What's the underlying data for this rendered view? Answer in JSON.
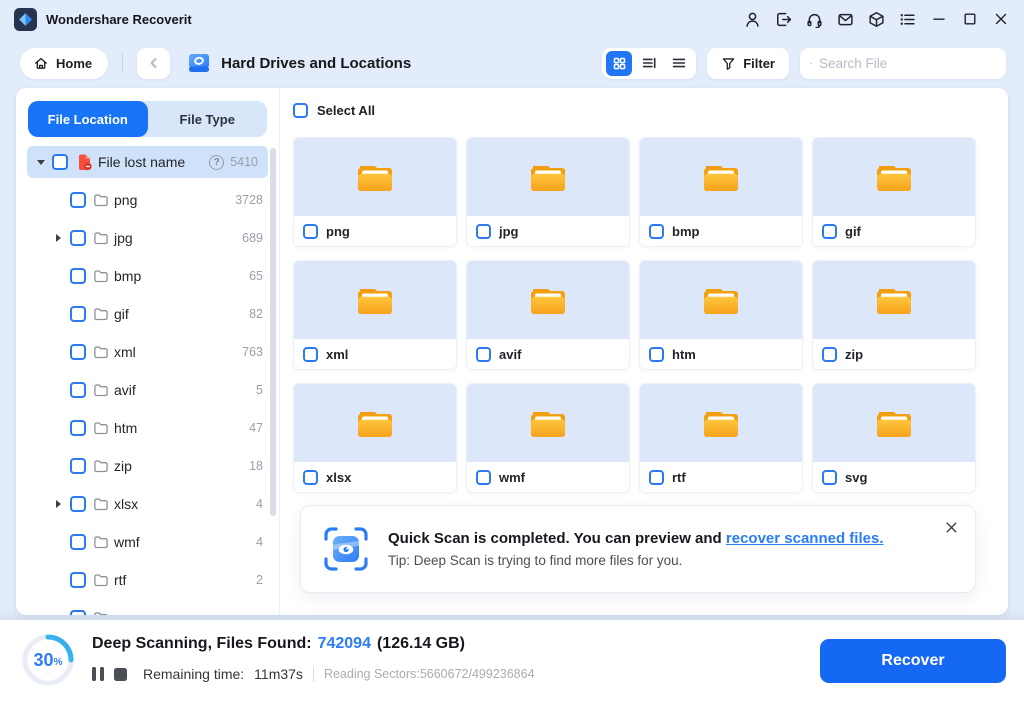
{
  "titlebar": {
    "app_title": "Wondershare Recoverit"
  },
  "toolbar": {
    "home_label": "Home",
    "breadcrumb_title": "Hard Drives and Locations",
    "filter_label": "Filter",
    "search_placeholder": "Search File"
  },
  "sidebar": {
    "tabs": [
      {
        "label": "File Location"
      },
      {
        "label": "File Type"
      }
    ],
    "root": {
      "label": "File lost name",
      "count": "5410"
    },
    "tree": [
      {
        "label": "png",
        "count": "3728"
      },
      {
        "label": "jpg",
        "count": "689"
      },
      {
        "label": "bmp",
        "count": "65"
      },
      {
        "label": "gif",
        "count": "82"
      },
      {
        "label": "xml",
        "count": "763"
      },
      {
        "label": "avif",
        "count": "5"
      },
      {
        "label": "htm",
        "count": "47"
      },
      {
        "label": "zip",
        "count": "18"
      },
      {
        "label": "xlsx",
        "count": "4"
      },
      {
        "label": "wmf",
        "count": "4"
      },
      {
        "label": "rtf",
        "count": "2"
      }
    ]
  },
  "main": {
    "select_all_label": "Select All",
    "folders": [
      {
        "label": "png"
      },
      {
        "label": "jpg"
      },
      {
        "label": "bmp"
      },
      {
        "label": "gif"
      },
      {
        "label": "xml"
      },
      {
        "label": "avif"
      },
      {
        "label": "htm"
      },
      {
        "label": "zip"
      },
      {
        "label": "xlsx"
      },
      {
        "label": "wmf"
      },
      {
        "label": "rtf"
      },
      {
        "label": "svg"
      }
    ],
    "notification": {
      "message": "Quick Scan is completed. You can preview and",
      "link": "recover scanned files.",
      "tip": "Tip: Deep Scan is trying to find more files for you."
    }
  },
  "footer": {
    "progress_value": "30",
    "progress_unit": "%",
    "status_label": "Deep Scanning, Files Found:",
    "files_found": "742094",
    "size_found": "(126.14 GB)",
    "remaining_label": "Remaining time:",
    "remaining_value": "11m37s",
    "sectors_label": "Reading Sectors:5660672/499236864",
    "recover_label": "Recover"
  },
  "colors": {
    "accent_blue": "#1774f6",
    "link_blue": "#2b7cf7",
    "folder_orange": "#f9a821",
    "progress_arc_cyan": "#4cc3f2",
    "card_bg": "#dce8f9"
  }
}
